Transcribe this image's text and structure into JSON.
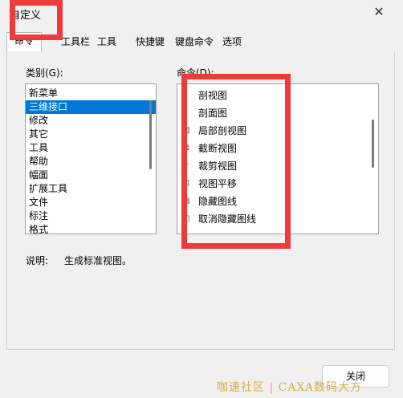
{
  "window": {
    "title": "自定义",
    "close_glyph": "✕"
  },
  "tabs": [
    {
      "label": "命令",
      "active": true
    },
    {
      "label": "工具栏",
      "active": false
    },
    {
      "label": "工具",
      "active": false
    },
    {
      "label": "快捷键",
      "active": false
    },
    {
      "label": "键盘命令",
      "active": false
    },
    {
      "label": "选项",
      "active": false
    }
  ],
  "category": {
    "label": "类别(G):",
    "items": [
      "新菜单",
      "三维接口",
      "修改",
      "其它",
      "工具",
      "帮助",
      "幅面",
      "扩展工具",
      "文件",
      "标注",
      "格式"
    ],
    "selected": "三维接口"
  },
  "commands": {
    "label": "命令(D):",
    "items": [
      {
        "label": "剖视图",
        "icon": "section-view-icon"
      },
      {
        "label": "剖面图",
        "icon": "section-plane-icon"
      },
      {
        "label": "局部剖视图",
        "icon": "partial-section-icon"
      },
      {
        "label": "截断视图",
        "icon": "broken-view-icon"
      },
      {
        "label": "裁剪视图",
        "icon": "crop-view-icon"
      },
      {
        "label": "视图平移",
        "icon": "pan-view-icon"
      },
      {
        "label": "隐藏图线",
        "icon": "hide-lines-icon"
      },
      {
        "label": "取消隐藏图线",
        "icon": "unhide-lines-icon"
      }
    ]
  },
  "description": {
    "label": "说明:",
    "text": "生成标准视图。"
  },
  "buttons": {
    "close": "关闭"
  },
  "watermark": "咖速社区 | CAXA数码大方",
  "colors": {
    "selection": "#0078d7",
    "highlight_box": "#ee3a3a",
    "watermark": "#d6a028"
  }
}
